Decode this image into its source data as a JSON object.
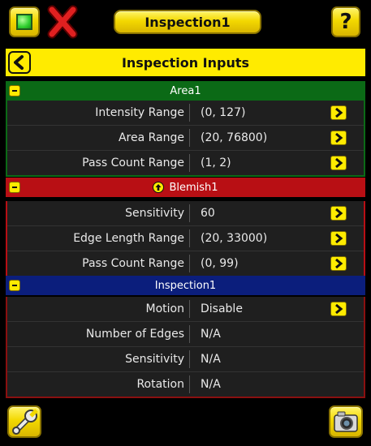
{
  "toolbar": {
    "title": "Inspection1",
    "help_label": "?"
  },
  "header": {
    "title": "Inspection Inputs"
  },
  "sections": [
    {
      "title": "Area1",
      "color": "#0b6a16",
      "rows": [
        {
          "label": "Intensity Range",
          "value": "(0, 127)"
        },
        {
          "label": "Area Range",
          "value": "(20, 76800)"
        },
        {
          "label": "Pass Count Range",
          "value": "(1, 2)"
        }
      ]
    },
    {
      "title": "Blemish1",
      "color": "#b80f14",
      "rows": [
        {
          "label": "Sensitivity",
          "value": "60"
        },
        {
          "label": "Edge Length Range",
          "value": "(20, 33000)"
        },
        {
          "label": "Pass Count Range",
          "value": "(0, 99)"
        }
      ]
    },
    {
      "title": "Inspection1",
      "color": "#0b1e7c",
      "rows": [
        {
          "label": "Motion",
          "value": "Disable"
        },
        {
          "label": "Number of Edges",
          "value": "N/A"
        },
        {
          "label": "Sensitivity",
          "value": "N/A"
        },
        {
          "label": "Rotation",
          "value": "N/A"
        }
      ]
    }
  ]
}
